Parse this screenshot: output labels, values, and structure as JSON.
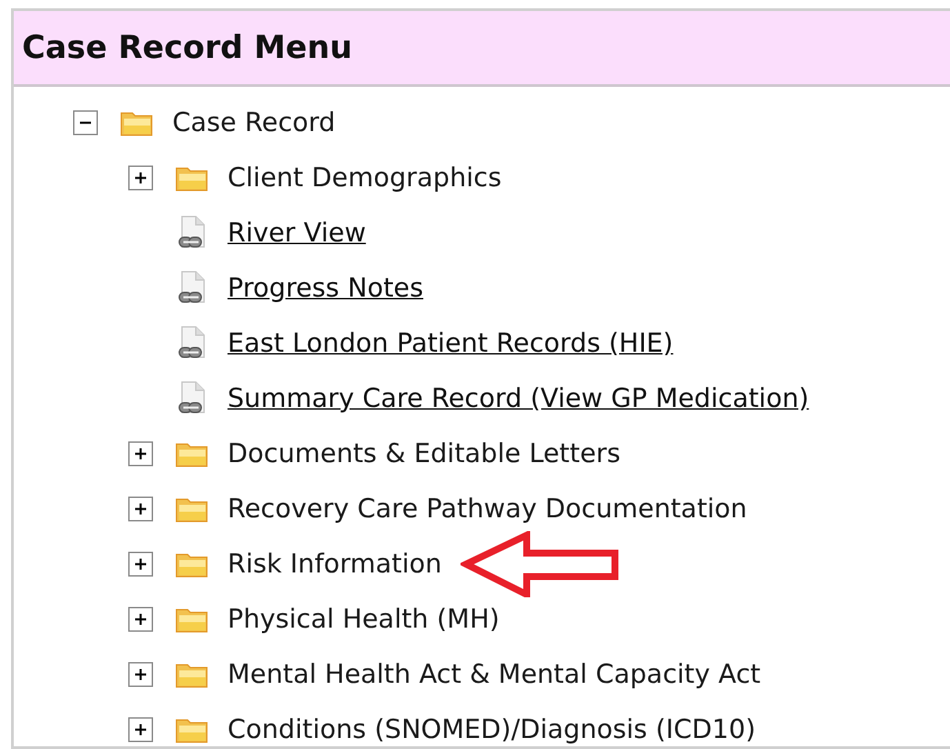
{
  "panel": {
    "title": "Case Record Menu"
  },
  "tree": [
    {
      "kind": "folder",
      "label": "Case Record",
      "expanded": true,
      "arrow": false,
      "children": [
        {
          "kind": "folder",
          "label": "Client Demographics",
          "expanded": false,
          "arrow": false
        },
        {
          "kind": "link",
          "label": "River View",
          "arrow": false
        },
        {
          "kind": "link",
          "label": "Progress Notes",
          "arrow": false
        },
        {
          "kind": "link",
          "label": "East London Patient Records (HIE)",
          "arrow": false
        },
        {
          "kind": "link",
          "label": "Summary Care Record (View GP Medication)",
          "arrow": false
        },
        {
          "kind": "folder",
          "label": "Documents & Editable Letters",
          "expanded": false,
          "arrow": false
        },
        {
          "kind": "folder",
          "label": "Recovery Care Pathway Documentation",
          "expanded": false,
          "arrow": false
        },
        {
          "kind": "folder",
          "label": "Risk Information",
          "expanded": false,
          "arrow": true
        },
        {
          "kind": "folder",
          "label": "Physical Health (MH)",
          "expanded": false,
          "arrow": false
        },
        {
          "kind": "folder",
          "label": "Mental Health Act & Mental Capacity Act",
          "expanded": false,
          "arrow": false
        },
        {
          "kind": "folder",
          "label": "Conditions (SNOMED)/Diagnosis (ICD10)",
          "expanded": false,
          "arrow": false
        }
      ]
    }
  ]
}
